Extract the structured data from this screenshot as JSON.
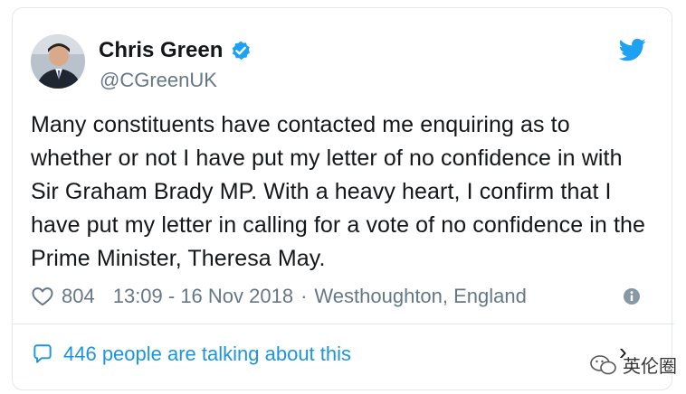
{
  "tweet": {
    "author_name": "Chris Green",
    "author_handle": "@CGreenUK",
    "body": "Many constituents have contacted me enquiring as to whether or not I have put my letter of no confidence in with Sir Graham Brady MP. With a heavy heart, I confirm that I have put my letter in calling for a vote of no confidence in the Prime Minister, Theresa May.",
    "likes": "804",
    "timestamp": "13:09 - 16 Nov 2018",
    "separator": "·",
    "location": "Westhoughton, England",
    "talking": "446 people are talking about this"
  },
  "watermark": {
    "text": "英伦圈"
  },
  "colors": {
    "accent": "#1da1f2",
    "link": "#1b95e0",
    "muted": "#657786",
    "text": "#14171a",
    "border": "#e1e8ed"
  },
  "icons": {
    "avatar": "avatar",
    "verified": "verified-badge-icon",
    "twitter": "twitter-bird-icon",
    "like": "heart-icon",
    "info": "info-icon",
    "reply": "speech-bubble-icon",
    "more": "chevron-right-icon"
  }
}
